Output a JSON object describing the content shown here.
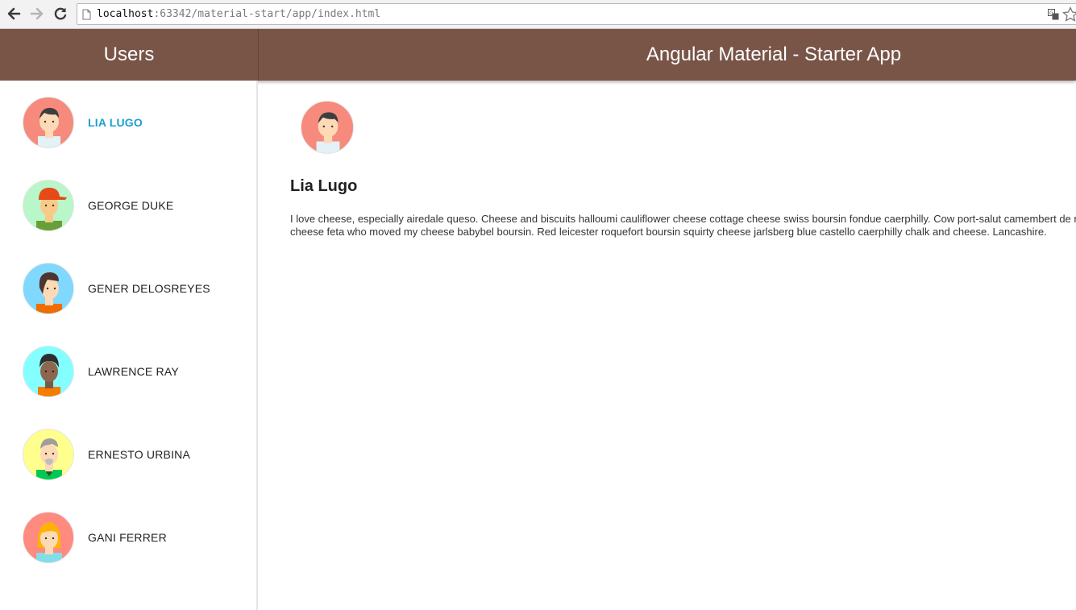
{
  "browser": {
    "url_host": "localhost",
    "url_rest": ":63342/material-start/app/index.html"
  },
  "toolbar": {
    "sidebar_title": "Users",
    "app_title": "Angular Material - Starter App",
    "color": "#795548"
  },
  "users": [
    {
      "name": "Lia Lugo",
      "selected": true,
      "avatar_bg": "#f58a7d"
    },
    {
      "name": "George Duke",
      "selected": false,
      "avatar_bg": "#b9f6ca"
    },
    {
      "name": "Gener Delosreyes",
      "selected": false,
      "avatar_bg": "#80d8ff"
    },
    {
      "name": "Lawrence Ray",
      "selected": false,
      "avatar_bg": "#84ffff"
    },
    {
      "name": "Ernesto Urbina",
      "selected": false,
      "avatar_bg": "#ffff8d"
    },
    {
      "name": "Gani Ferrer",
      "selected": false,
      "avatar_bg": "#ff8a80"
    }
  ],
  "detail": {
    "name": "Lia Lugo",
    "bio_line1": "I love cheese, especially airedale queso. Cheese and biscuits halloumi cauliflower cheese cottage cheese swiss boursin fondue caerphilly. Cow port-salut camembert de normandie macaroni cheese feta who moved my cheese babybel boursin.",
    "bio_line2": "cheese feta who moved my cheese babybel boursin. Red leicester roquefort boursin squirty cheese jarlsberg blue castello caerphilly chalk and cheese. Lancashire."
  },
  "icons": {
    "back": "arrow-left-icon",
    "forward": "arrow-right-icon",
    "reload": "reload-icon",
    "page": "page-icon",
    "translate": "translate-icon",
    "star": "star-icon"
  }
}
